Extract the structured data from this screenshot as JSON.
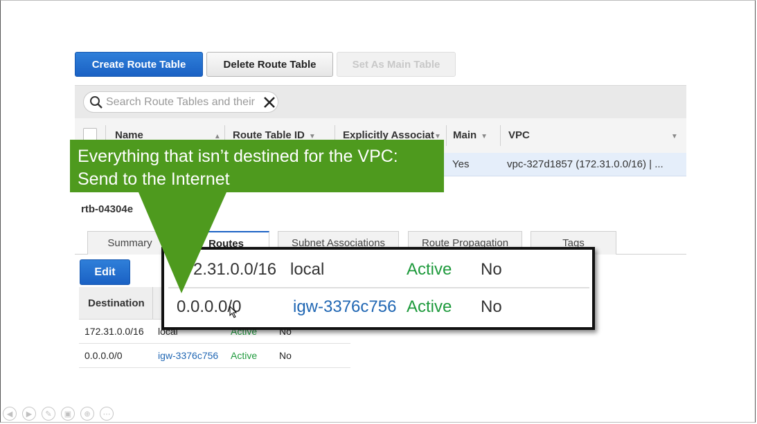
{
  "toolbar": {
    "create_label": "Create Route Table",
    "delete_label": "Delete Route Table",
    "set_main_label": "Set As Main Table"
  },
  "search": {
    "placeholder": "Search Route Tables and their"
  },
  "table": {
    "columns": [
      "Name",
      "Route Table ID",
      "Explicitly Associat",
      "Main",
      "VPC"
    ],
    "selected_row": {
      "main": "Yes",
      "vpc": "vpc-327d1857 (172.31.0.0/16) | ..."
    }
  },
  "detail": {
    "title": "rtb-04304e",
    "tabs": [
      "Summary",
      "Routes",
      "Subnet Associations",
      "Route Propagation",
      "Tags"
    ],
    "active_tab": "Routes",
    "edit_label": "Edit",
    "routes_header": {
      "destination": "Destination"
    },
    "routes": [
      {
        "destination": "172.31.0.0/16",
        "target": "local",
        "status": "Active",
        "propagated": "No"
      },
      {
        "destination": "0.0.0.0/0",
        "target": "igw-3376c756",
        "status": "Active",
        "propagated": "No"
      }
    ]
  },
  "zoom": {
    "rows": [
      {
        "destination": "2.31.0.0/16",
        "target": "local",
        "status": "Active",
        "propagated": "No"
      },
      {
        "destination": "0.0.0.0/0",
        "target": "igw-3376c756",
        "status": "Active",
        "propagated": "No"
      }
    ]
  },
  "callout": {
    "line1": "Everything that isn’t destined for the VPC:",
    "line2": "Send to the Internet"
  },
  "colors": {
    "primary": "#1a61c4",
    "callout": "#4e9a1e",
    "active": "#1e9a3c",
    "link": "#1f66b3"
  },
  "slide_controls": [
    "prev-icon",
    "next-icon",
    "pen-icon",
    "slides-icon",
    "zoom-icon",
    "more-icon"
  ]
}
